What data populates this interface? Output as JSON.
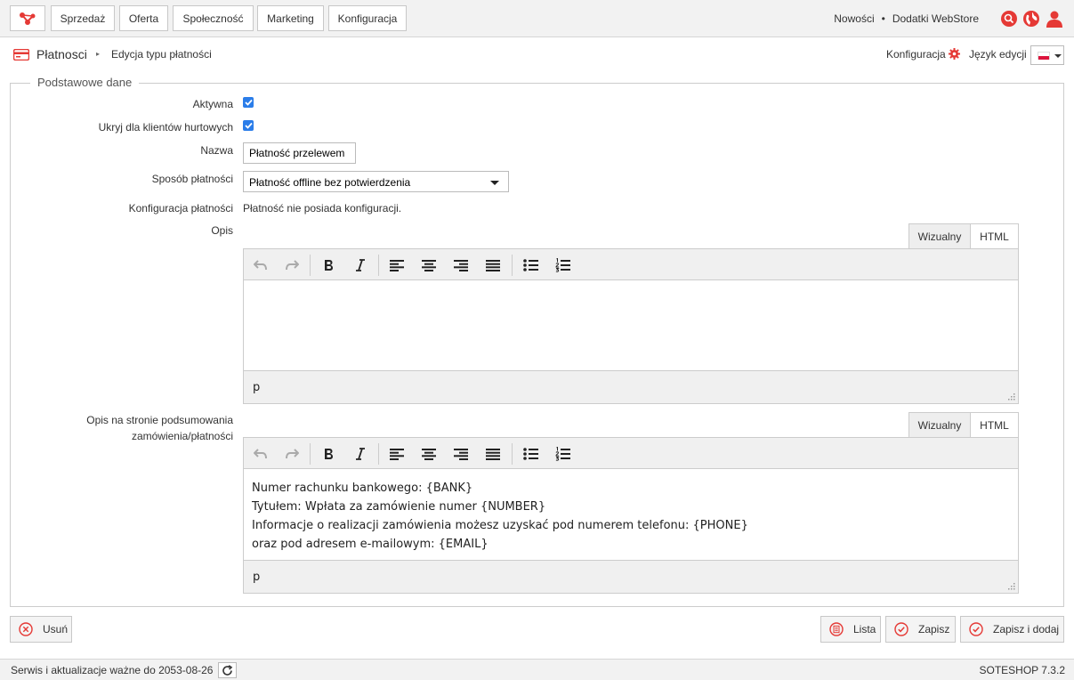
{
  "nav": {
    "items": [
      "Sprzedaż",
      "Oferta",
      "Społeczność",
      "Marketing",
      "Konfiguracja"
    ],
    "news": "Nowości",
    "separator": "•",
    "addons": "Dodatki WebStore"
  },
  "breadcrumb": {
    "section": "Płatnosci",
    "separator": "▸",
    "page": "Edycja typu płatności"
  },
  "header_right": {
    "config": "Konfiguracja",
    "language_label": "Język edycji"
  },
  "form": {
    "legend": "Podstawowe dane",
    "active_label": "Aktywna",
    "active_checked": true,
    "hide_wholesale_label": "Ukryj dla klientów hurtowych",
    "hide_wholesale_checked": true,
    "name_label": "Nazwa",
    "name_value": "Płatność przelewem",
    "method_label": "Sposób płatności",
    "method_value": "Płatność offline bez potwierdzenia",
    "config_label": "Konfiguracja płatności",
    "config_value": "Płatność nie posiada konfiguracji.",
    "desc_label": "Opis",
    "summary_label_line1": "Opis na stronie podsumowania",
    "summary_label_line2": "zamówienia/płatności"
  },
  "editor": {
    "tab_visual": "Wizualny",
    "tab_html": "HTML",
    "path": "p"
  },
  "summary_content": [
    "Numer rachunku bankowego: {BANK}",
    "Tytułem: Wpłata za zamówienie numer {NUMBER}",
    "Informacje o realizacji zamówienia możesz uzyskać pod numerem telefonu: {PHONE}",
    "oraz pod adresem e-mailowym: {EMAIL}"
  ],
  "actions": {
    "delete": "Usuń",
    "list": "Lista",
    "save": "Zapisz",
    "save_add": "Zapisz i dodaj"
  },
  "footer": {
    "service": "Serwis i aktualizacje ważne do 2053-08-26",
    "version": "SOTESHOP 7.3.2"
  },
  "colors": {
    "accent": "#e53935",
    "checkbox": "#2b7de9"
  }
}
